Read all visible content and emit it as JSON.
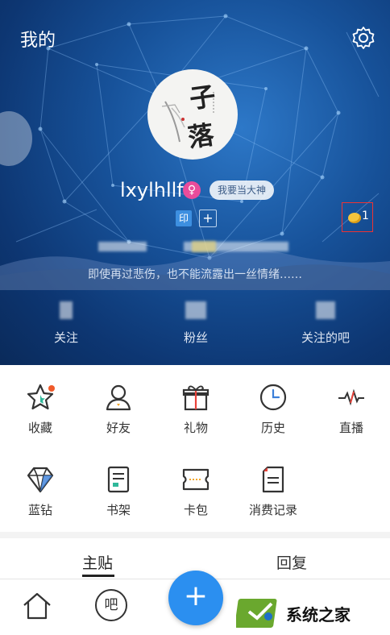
{
  "header": {
    "title": "我的",
    "username": "lxylhllf",
    "gender_symbol": "♀",
    "god_button": "我要当大神",
    "badge_yin": "印",
    "badge_plus": "+",
    "coin_count": "1",
    "signature": "即使再过悲伤，也不能流露出一丝情绪……",
    "avatar_chars": [
      "子",
      "落"
    ]
  },
  "stats": {
    "following": "关注",
    "fans": "粉丝",
    "followed_bars": "关注的吧"
  },
  "menu": {
    "row1": [
      "收藏",
      "好友",
      "礼物",
      "历史",
      "直播"
    ],
    "row2": [
      "蓝钻",
      "书架",
      "卡包",
      "消费记录"
    ]
  },
  "tabs": {
    "posts": "主贴",
    "replies": "回复"
  },
  "bottom_nav": {
    "bar": "吧",
    "fab": "+"
  },
  "watermark": "系统之家",
  "colors": {
    "accent": "#2b8ff0",
    "header_bg": "#17529a",
    "gender": "#ea4c9b",
    "notification": "#f05a2a",
    "highlight_box": "#ee3333"
  }
}
